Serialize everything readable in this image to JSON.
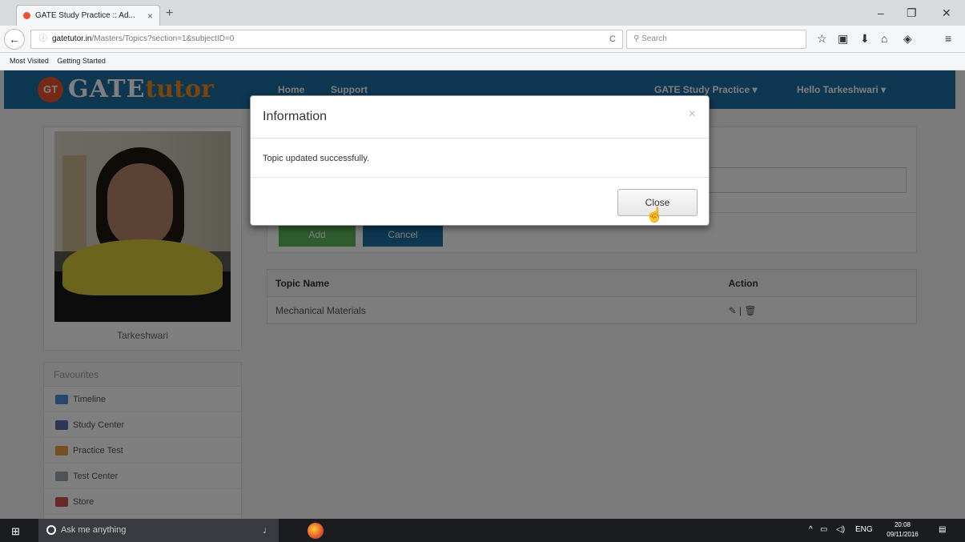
{
  "browser": {
    "tab_title": "GATE Study Practice :: Ad...",
    "tab_close": "×",
    "new_tab": "+",
    "url_host": "gatetutor.in",
    "url_path": "/Masters/Topics?section=1&subjectID=0",
    "search_placeholder": "Search",
    "bookmarks": [
      "Most Visited",
      "Getting Started"
    ]
  },
  "site": {
    "logo_badge": "GT",
    "logo_gate": "GATE",
    "logo_tutor": "tutor",
    "nav": {
      "home": "Home",
      "support": "Support",
      "study_practice": "GATE Study Practice ▾",
      "user_menu": "Hello Tarkeshwari ▾"
    }
  },
  "profile": {
    "name": "Tarkeshwari"
  },
  "favourites": {
    "title": "Favourites",
    "items": [
      {
        "label": "Timeline",
        "color": "#4a90d9"
      },
      {
        "label": "Study Center",
        "color": "#5b6fa8"
      },
      {
        "label": "Practice Test",
        "color": "#e8a33d"
      },
      {
        "label": "Test Center",
        "color": "#9aa7b2"
      },
      {
        "label": "Store",
        "color": "#d24f4f"
      }
    ]
  },
  "form": {
    "add_label": "Add",
    "cancel_label": "Cancel"
  },
  "table": {
    "headers": [
      "Topic Name",
      "Action"
    ],
    "rows": [
      {
        "topic": "Mechanical Materials",
        "action": "✎ | 🗑"
      }
    ]
  },
  "modal": {
    "title": "Information",
    "close_x": "×",
    "message": "Topic updated successfully.",
    "close_button": "Close"
  },
  "taskbar": {
    "search_placeholder": "Ask me anything",
    "lang": "ENG",
    "time": "20:08",
    "date": "09/11/2016"
  }
}
